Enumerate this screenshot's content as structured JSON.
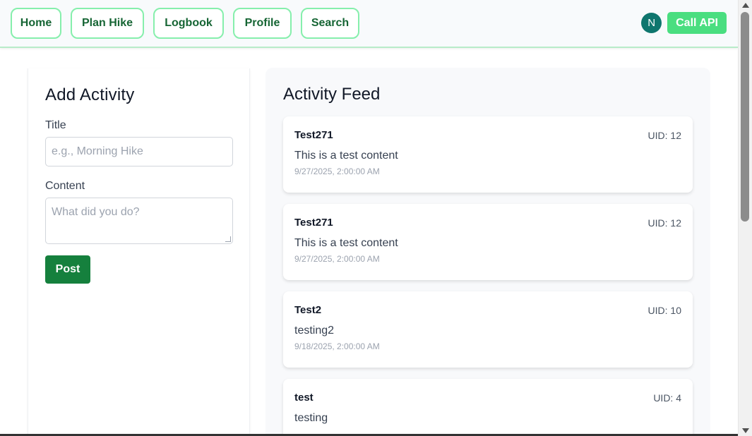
{
  "nav": {
    "items": [
      {
        "label": "Home"
      },
      {
        "label": "Plan Hike"
      },
      {
        "label": "Logbook"
      },
      {
        "label": "Profile"
      },
      {
        "label": "Search"
      }
    ],
    "avatar_initial": "N",
    "call_api_label": "Call API"
  },
  "add_activity": {
    "heading": "Add Activity",
    "title_label": "Title",
    "title_placeholder": "e.g., Morning Hike",
    "content_label": "Content",
    "content_placeholder": "What did you do?",
    "post_label": "Post"
  },
  "feed": {
    "heading": "Activity Feed",
    "items": [
      {
        "title": "Test271",
        "uid": "UID: 12",
        "content": "This is a test content",
        "time": "9/27/2025, 2:00:00 AM"
      },
      {
        "title": "Test271",
        "uid": "UID: 12",
        "content": "This is a test content",
        "time": "9/27/2025, 2:00:00 AM"
      },
      {
        "title": "Test2",
        "uid": "UID: 10",
        "content": "testing2",
        "time": "9/18/2025, 2:00:00 AM"
      },
      {
        "title": "test",
        "uid": "UID: 4",
        "content": "testing",
        "time": ""
      }
    ]
  },
  "colors": {
    "accent": "#15803d",
    "nav_border": "#86efac",
    "api_button": "#4ade80",
    "avatar": "#0f766e"
  }
}
